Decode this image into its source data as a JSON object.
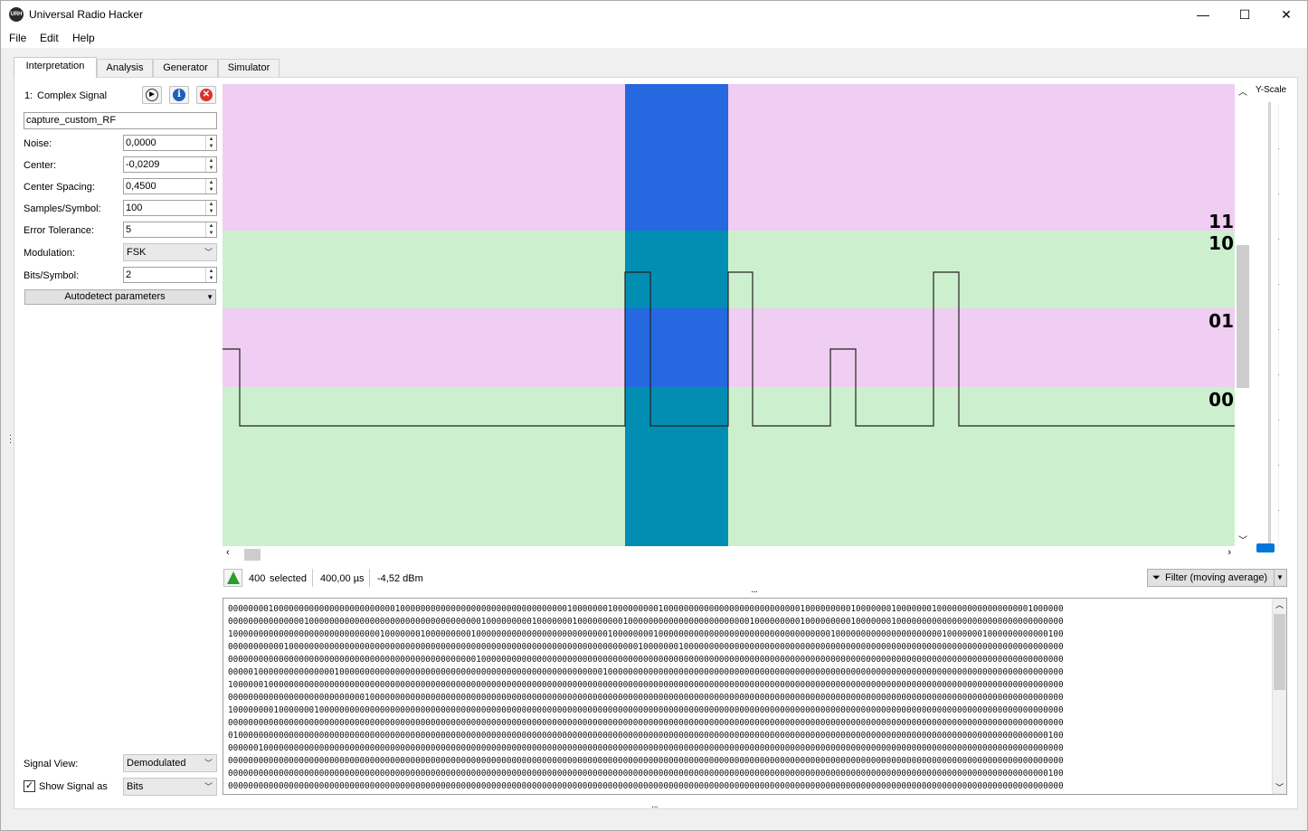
{
  "window": {
    "title": "Universal Radio Hacker",
    "icon_text": "URH",
    "minimize": "—",
    "maximize": "☐",
    "close": "✕"
  },
  "menu": [
    "File",
    "Edit",
    "Help"
  ],
  "tabs": [
    "Interpretation",
    "Analysis",
    "Generator",
    "Simulator"
  ],
  "signal": {
    "index_label": "1:",
    "type_label": "Complex Signal",
    "name": "capture_custom_RF",
    "params": [
      {
        "label": "Noise:",
        "value": "0,0000"
      },
      {
        "label": "Center:",
        "value": "-0,0209"
      },
      {
        "label": "Center Spacing:",
        "value": "0,4500"
      },
      {
        "label": "Samples/Symbol:",
        "value": "100"
      },
      {
        "label": "Error Tolerance:",
        "value": "5"
      }
    ],
    "modulation_label": "Modulation:",
    "modulation_value": "FSK",
    "bits_per_symbol_label": "Bits/Symbol:",
    "bits_per_symbol_value": "2",
    "autodetect_label": "Autodetect parameters",
    "signal_view_label": "Signal View:",
    "signal_view_value": "Demodulated",
    "show_signal_as_label": "Show Signal as",
    "show_signal_as_value": "Bits",
    "show_signal_checked": true
  },
  "plot": {
    "levels": [
      "11",
      "10",
      "01",
      "00"
    ],
    "band_colors": {
      "pink": "#f0cdf2",
      "green": "#ccf0cd",
      "sel_pink": "#2568e0",
      "sel_green": "#028db3"
    },
    "y_scale_label": "Y-Scale"
  },
  "status": {
    "selected_count": "400",
    "selected_label": "selected",
    "duration": "400,00 µs",
    "power": "-4,52 dBm",
    "filter_label": "Filter (moving average)"
  },
  "bits_rows": [
    "000000001000000000000000000000000100000000000000000000000000000000010000000100000000010000000000000000000000000001000000000100000001000000010000000000000000001000000",
    "000000000000000100000000000000000000000000000000001000000000100000001000000000100000000000000000000000010000000001000000000100000001000000000000000000000000000000000",
    "100000000000000000000000000000100000001000000000100000000000000000000000000100000000100000000000000000000000000000000001000000000000000000000100000001000000000000100",
    "000000000001000000000000000000000000000000000000000000000000000000000000000000000100000001000000000000000000000000000000000000000000000000000000000000000000000000000",
    "000000000000000000000000000000000000000000000000010000000000000000000000000000000000000000000000000000000000000000000000000000000000000000000000000000000000000000000",
    "000001000000000000000100000000000000000000000000000000000000000000000000001000000000000000000000000000000000000000000000000000000000000000000000000000000000000000000",
    "100000010000000000000000000000000000000000000000000000000000000000000000000000000000000000000000000000000000000000000000000000000000000000000000000000000000000000000",
    "000000000000000000000000000100000000000000000000000000000000000000000000000000000000000000000000000000000000000000000000000000000000000000000000000000000000000000000",
    "100000000100000001000000000000000000000000000000000000000000000000000000000000000000000000000000000000000000000000000000000000000000000000000000000000000000000000000",
    "000000000000000000000000000000000000000000000000000000000000000000000000000000000000000000000000000000000000000000000000000000000000000000000000000000000000000000000",
    "010000000000000000000000000000000000000000000000000000000000000000000000000000000000000000000000000000000000000000000000000000000000000000000000000000000000000000100",
    "000000100000000000000000000000000000000000000000000000000000000000000000000000000000000000000000000000000000000000000000000000000000000000000000000000000000000000000",
    "000000000000000000000000000000000000000000000000000000000000000000000000000000000000000000000000000000000000000000000000000000000000000000000000000000000000000000000",
    "000000000000000000000000000000000000000000000000000000000000000000000000000000000000000000000000000000000000000000000000000000000000000000000000000000000000000000100",
    "000000000000000000000000000000000000000000000000000000000000000000000000000000000000000000000000000000000000000000000000000000000000000000000000000000000000000000000",
    "000000000000000000000000000000000000000000000000000000000000000000000000000000000000000000000000000000000000000000000000000000000000000000000000000000000000000000100"
  ]
}
